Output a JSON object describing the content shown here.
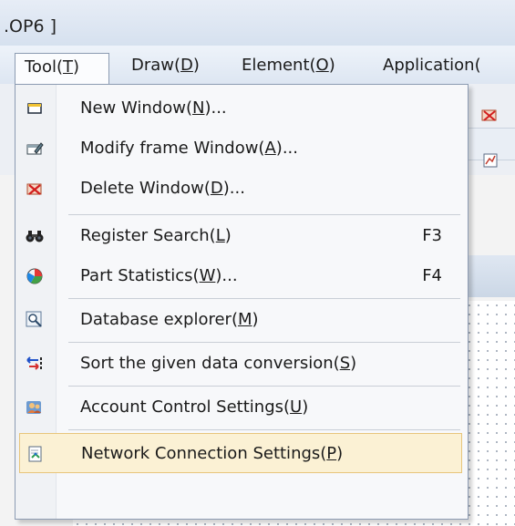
{
  "window": {
    "title": ".OP6 ]"
  },
  "menubar": {
    "items": [
      {
        "pre": "Tool(",
        "key": "T",
        "post": ")"
      },
      {
        "pre": "Draw(",
        "key": "D",
        "post": ")"
      },
      {
        "pre": "Element(",
        "key": "O",
        "post": ")"
      },
      {
        "pre": "Application(",
        "key": "",
        "post": ""
      }
    ]
  },
  "tool_menu": {
    "items": [
      {
        "pre": "New Window(",
        "key": "N",
        "post": ")...",
        "shortcut": "",
        "icon": "window-icon"
      },
      {
        "pre": "Modify frame Window(",
        "key": "A",
        "post": ")...",
        "shortcut": "",
        "icon": "modify-window-icon"
      },
      {
        "pre": "Delete Window(",
        "key": "D",
        "post": ")...",
        "shortcut": "",
        "icon": "delete-window-icon"
      },
      {
        "pre": "Register Search(",
        "key": "L",
        "post": ")",
        "shortcut": "F3",
        "icon": "binoculars-icon"
      },
      {
        "pre": "Part Statistics(",
        "key": "W",
        "post": ")...",
        "shortcut": "F4",
        "icon": "statistics-icon"
      },
      {
        "pre": "Database explorer(",
        "key": "M",
        "post": ")",
        "shortcut": "",
        "icon": "database-explorer-icon"
      },
      {
        "pre": "Sort the given data conversion(",
        "key": "S",
        "post": ")",
        "shortcut": "",
        "icon": "sort-conversion-icon"
      },
      {
        "pre": "Account Control Settings(",
        "key": "U",
        "post": ")",
        "shortcut": "",
        "icon": "account-settings-icon"
      },
      {
        "pre": "Network Connection Settings(",
        "key": "P",
        "post": ")",
        "shortcut": "",
        "icon": "network-settings-icon"
      }
    ],
    "highlighted_index": 8
  },
  "colors": {
    "highlight_bg": "#fbf1d4",
    "highlight_border": "#e7c57b",
    "menu_border": "#8c9bb2"
  }
}
